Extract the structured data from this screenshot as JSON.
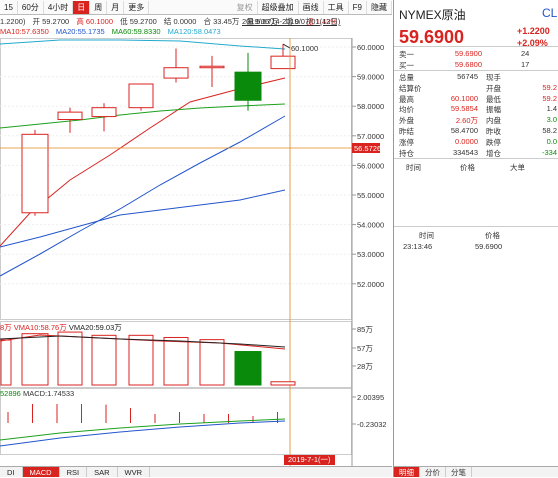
{
  "toolbar": {
    "left": [
      "15",
      "60分",
      "4小时",
      "日",
      "周",
      "月",
      "更多"
    ],
    "active": "日",
    "right": [
      "复权",
      "超级叠加",
      "画线",
      "工具",
      "F9",
      "隐藏"
    ]
  },
  "info": {
    "prefix": "1.2200)",
    "open": "开 59.2700",
    "high": "高 60.1000",
    "low": "低 59.2700",
    "close": "结 0.0000",
    "amount": "合 33.45万",
    "volume": "量 5.67万",
    "increase": "增 0",
    "amplitude": "振 1.43%",
    "ma10": "MA10:57.6350",
    "ma20": "MA20:55.1735",
    "ma60": "MA60:59.8330",
    "ma120": "MA120:58.0473",
    "date_range": "2019/06/14-2019/07/01(12日)"
  },
  "price_axis": [
    "60.0000",
    "59.0000",
    "58.0000",
    "57.0000",
    "56.0000",
    "55.0000",
    "54.0000",
    "53.0000",
    "52.0000"
  ],
  "crosshair_price": "56.5726",
  "max_label": "60.1000",
  "volume": {
    "info_prefix": "8万",
    "vma10": "VMA10:58.76万",
    "vma20": "VMA20:59.03万",
    "axis": [
      "85万",
      "57万",
      "28万"
    ]
  },
  "macd": {
    "info_prefix": "52896",
    "macd": "MACD:1.74533",
    "axis": [
      "2.00395",
      "-0.23032"
    ]
  },
  "crosshair_date": "2019-7-1(一)",
  "bottom_tabs": [
    "DI",
    "MACD",
    "RSI",
    "SAR",
    "WVR"
  ],
  "bottom_tab_active": "MACD",
  "quote": {
    "name": "NYMEX原油",
    "code_partial": "CL",
    "price": "59.6900",
    "change": "+1.2200",
    "change_pct": "+2.09%",
    "sell": {
      "label": "卖一",
      "price": "59.6900",
      "qty": "24"
    },
    "buy": {
      "label": "买一",
      "price": "59.6800",
      "qty": "17"
    },
    "stats_left": [
      {
        "label": "总量",
        "value": "56745",
        "color": "#333333"
      },
      {
        "label": "结算价",
        "value": "",
        "color": "#333333"
      },
      {
        "label": "最高",
        "value": "60.1000",
        "color": "#d9231f"
      },
      {
        "label": "均价",
        "value": "59.5854",
        "color": "#d9231f"
      },
      {
        "label": "外盘",
        "value": "2.60万",
        "color": "#d9231f"
      },
      {
        "label": "昨结",
        "value": "58.4700",
        "color": "#333333"
      },
      {
        "label": "涨停",
        "value": "0.0000",
        "color": "#d9231f"
      },
      {
        "label": "持仓",
        "value": "334543",
        "color": "#333333"
      }
    ],
    "stats_right": [
      {
        "label": "现手",
        "value": "",
        "color": "#333333"
      },
      {
        "label": "开盘",
        "value": "59.2",
        "color": "#d9231f"
      },
      {
        "label": "最低",
        "value": "59.2",
        "color": "#d9231f"
      },
      {
        "label": "振幅",
        "value": "1.4",
        "color": "#333333"
      },
      {
        "label": "内盘",
        "value": "3.0",
        "color": "#0a8a0a"
      },
      {
        "label": "昨收",
        "value": "58.2",
        "color": "#333333"
      },
      {
        "label": "跌停",
        "value": "0.0",
        "color": "#0a8a0a"
      },
      {
        "label": "增仓",
        "value": "-334",
        "color": "#0a8a0a"
      }
    ],
    "trades_header": [
      "时间",
      "价格",
      "大单"
    ],
    "ticks_header": [
      "时间",
      "价格"
    ],
    "ticks": [
      {
        "time": "23:13:46",
        "price": "59.6900"
      }
    ],
    "tabs": [
      "明细",
      "分价",
      "分笔"
    ],
    "tab_active": "明细"
  },
  "colors": {
    "up": "#d9231f",
    "down": "#0a8a0a",
    "ma10": "#d9231f",
    "ma20": "#2255cc",
    "ma60": "#1ba01b",
    "ma120": "#22aacc",
    "crosshair": "#e08a1e"
  },
  "chart_data": {
    "type": "candlestick",
    "candles": [
      {
        "open": 54.4,
        "high": 57.2,
        "low": 54.3,
        "close": 57.05
      },
      {
        "open": 57.55,
        "high": 57.95,
        "low": 57.1,
        "close": 57.8
      },
      {
        "open": 57.65,
        "high": 58.1,
        "low": 57.15,
        "close": 57.95
      },
      {
        "open": 57.95,
        "high": 58.75,
        "low": 57.85,
        "close": 58.75
      },
      {
        "open": 58.95,
        "high": 59.95,
        "low": 58.8,
        "close": 59.3
      },
      {
        "open": 59.3,
        "high": 59.7,
        "low": 58.65,
        "close": 59.35
      },
      {
        "open": 59.15,
        "high": 59.8,
        "low": 57.85,
        "close": 58.2
      },
      {
        "open": 59.27,
        "high": 60.1,
        "low": 59.27,
        "close": 59.69
      }
    ],
    "volumes": [
      0.95,
      0.98,
      0.92,
      0.92,
      0.88,
      0.84,
      0.62,
      0.06
    ],
    "macd_bars": [
      0.55,
      0.95,
      0.95,
      0.95,
      0.92,
      0.75,
      0.45,
      0.55,
      0.45,
      0.45,
      0.35,
      0.55
    ]
  }
}
